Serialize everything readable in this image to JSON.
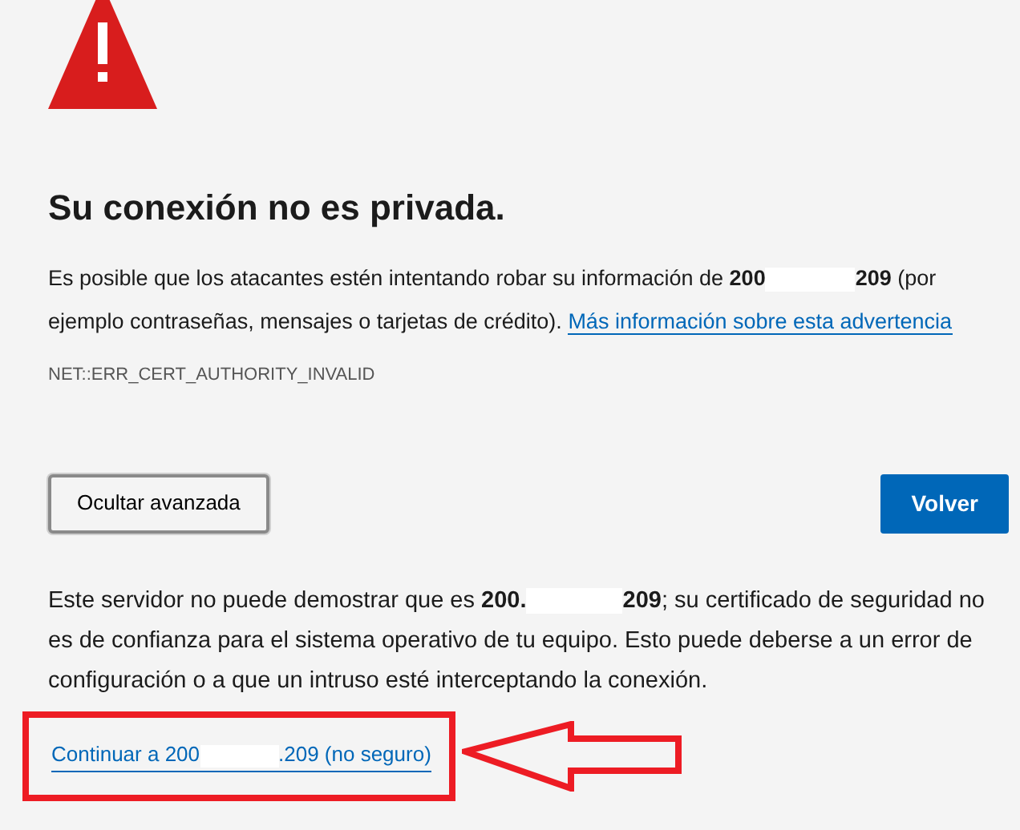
{
  "title": "Su conexión no es privada.",
  "intro": {
    "before": "Es posible que los atacantes estén intentando robar su información de",
    "host_start": "200",
    "host_end": "209",
    "after": "(por ejemplo contraseñas, mensajes o tarjetas de crédito).",
    "link": "Más información sobre esta advertencia"
  },
  "error_code": "NET::ERR_CERT_AUTHORITY_INVALID",
  "buttons": [
    {
      "label": "Ocultar avanzada",
      "kind": "secondary"
    },
    {
      "label": "Volver",
      "kind": "primary"
    }
  ],
  "details": {
    "before": "Este servidor no puede demostrar que es",
    "host_start": "200.",
    "host_end": "209",
    "after": "; su certificado de seguridad no es de confianza para el sistema operativo de tu equipo. Esto puede deberse a un error de configuración o a que un intruso esté interceptando la conexión."
  },
  "proceed_link": {
    "start": "Continuar a 200",
    "end": ".209 (no seguro)"
  },
  "annotation": {
    "kind": "box-arrow",
    "color": "#ed1c24"
  }
}
